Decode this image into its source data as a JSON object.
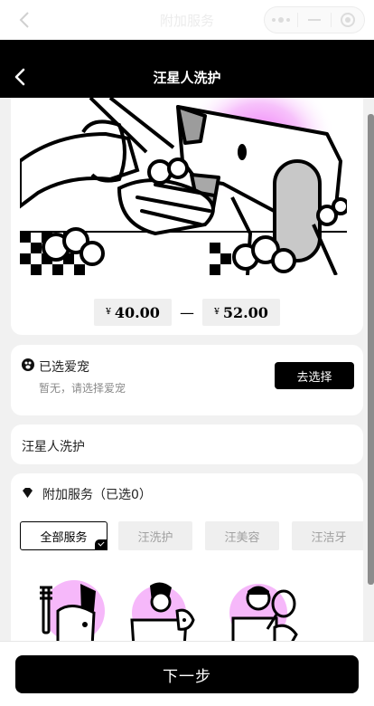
{
  "native_bar": {
    "title": "附加服务"
  },
  "header": {
    "title": "汪星人洗护"
  },
  "price": {
    "currency": "¥",
    "min": "40.00",
    "dash": "—",
    "max": "52.00"
  },
  "pet": {
    "title": "已选爱宠",
    "subtitle": "暂无，请选择爱宠",
    "choose_label": "去选择"
  },
  "service": {
    "name": "汪星人洗护"
  },
  "addon": {
    "title": "附加服务（已选0）",
    "tabs": [
      {
        "label": "全部服务",
        "active": true
      },
      {
        "label": "汪洗护",
        "active": false
      },
      {
        "label": "汪美容",
        "active": false
      },
      {
        "label": "汪洁牙",
        "active": false
      }
    ]
  },
  "footer": {
    "next_label": "下一步"
  },
  "colors": {
    "accent": "#000000",
    "highlight": "#f07cf7"
  }
}
